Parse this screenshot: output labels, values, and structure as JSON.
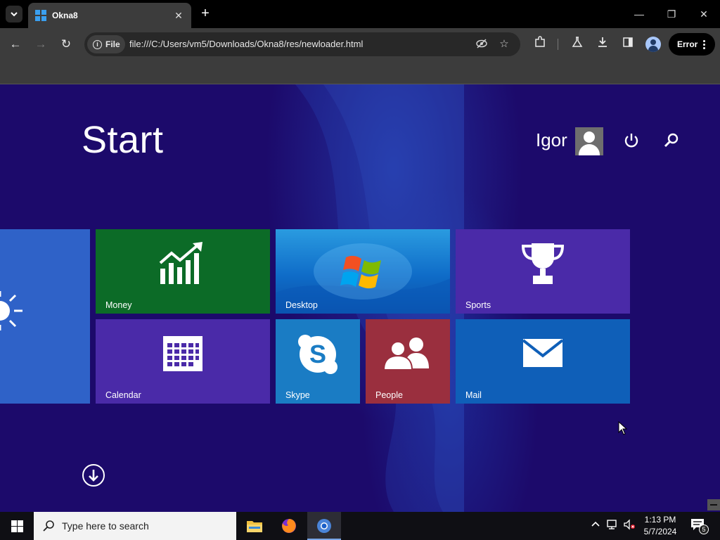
{
  "browser": {
    "tab_title": "Okna8",
    "site_chip": "File",
    "url": "file:///C:/Users/vm5/Downloads/Okna8/res/newloader.html",
    "error_label": "Error"
  },
  "start": {
    "title": "Start",
    "user_name": "Igor"
  },
  "tiles": {
    "money": "Money",
    "desktop": "Desktop",
    "sports": "Sports",
    "calendar": "Calendar",
    "skype": "Skype",
    "people": "People",
    "mail": "Mail"
  },
  "taskbar": {
    "search_placeholder": "Type here to search",
    "time": "1:13 PM",
    "date": "5/7/2024",
    "notification_count": "5"
  },
  "colors": {
    "page_bg": "#1c0a6b",
    "money_tile": "#0c6b27",
    "sports_tile": "#4a2aa8",
    "calendar_tile": "#4a2aa8",
    "skype_tile": "#1a7cc4",
    "people_tile": "#9a2f3e",
    "mail_tile": "#0f5fb8",
    "weather_tile": "#2f62c8"
  }
}
